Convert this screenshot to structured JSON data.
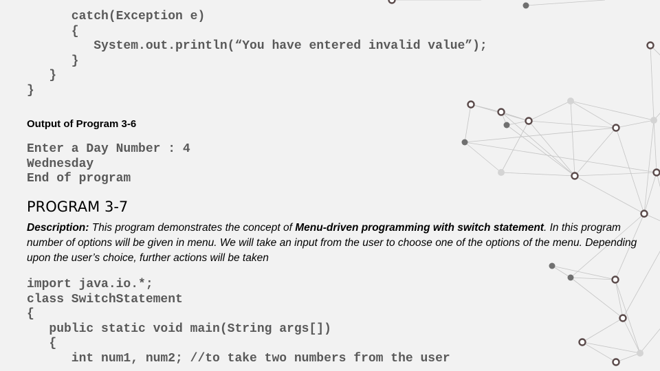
{
  "code_top": [
    "      catch(Exception e)",
    "      {",
    "         System.out.println(“You have entered invalid value”);",
    "      }",
    "   }",
    "}"
  ],
  "output_heading": "Output of Program 3-6",
  "output_lines": [
    "Enter a Day Number : 4",
    "Wednesday",
    "End of program"
  ],
  "program_title": "PROGRAM 3-7",
  "description": {
    "label": "Description:",
    "text_1": " This program demonstrates the concept of ",
    "emphasis": "Menu-driven programming with switch statement",
    "text_2": ". In this program number of options will be given in menu. We will take an input from the user to choose one of the options of the menu. Depending upon the user’s choice, further actions will be taken"
  },
  "code_bottom": [
    "import java.io.*;",
    "class SwitchStatement",
    "{",
    "   public static void main(String args[])",
    "   {",
    "      int num1, num2; //to take two numbers from the user"
  ],
  "colors": {
    "background": "#f2f2f2",
    "code_text": "#595959",
    "network_line": "#c4c4c4"
  }
}
